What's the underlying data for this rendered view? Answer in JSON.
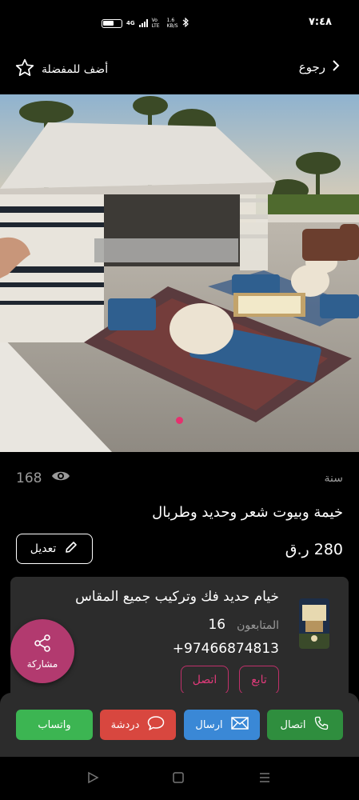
{
  "status": {
    "time": "٧:٤٨",
    "network_4g": "4G",
    "volte": "Vo LTE",
    "speed_value": "1.6",
    "speed_unit": "KB/S"
  },
  "topbar": {
    "back_label": "رجوع",
    "favorite_label": "أضف للمفضلة"
  },
  "listing": {
    "year_label": "سنة",
    "views_count": "168",
    "title": "خيمة وبيوت شعر وحديد وطربال",
    "price": "280 ر.ق",
    "edit_label": "تعديل"
  },
  "seller": {
    "name": "خيام حديد فك وتركيب جميع المقاس",
    "followers_label": "المتابعون",
    "followers_count": "16",
    "phone": "+97466874813",
    "follow_label": "تابع",
    "call_label": "اتصل"
  },
  "share": {
    "label": "مشاركة"
  },
  "actions": {
    "call": "اتصال",
    "send": "ارسال",
    "chat": "دردشة",
    "whatsapp": "واتساب"
  },
  "colors": {
    "accent_pink": "#b23a6f",
    "call_green": "#2f8e3e",
    "send_blue": "#3a88d6",
    "chat_red": "#d8473f",
    "whatsapp_green": "#3cb552"
  }
}
